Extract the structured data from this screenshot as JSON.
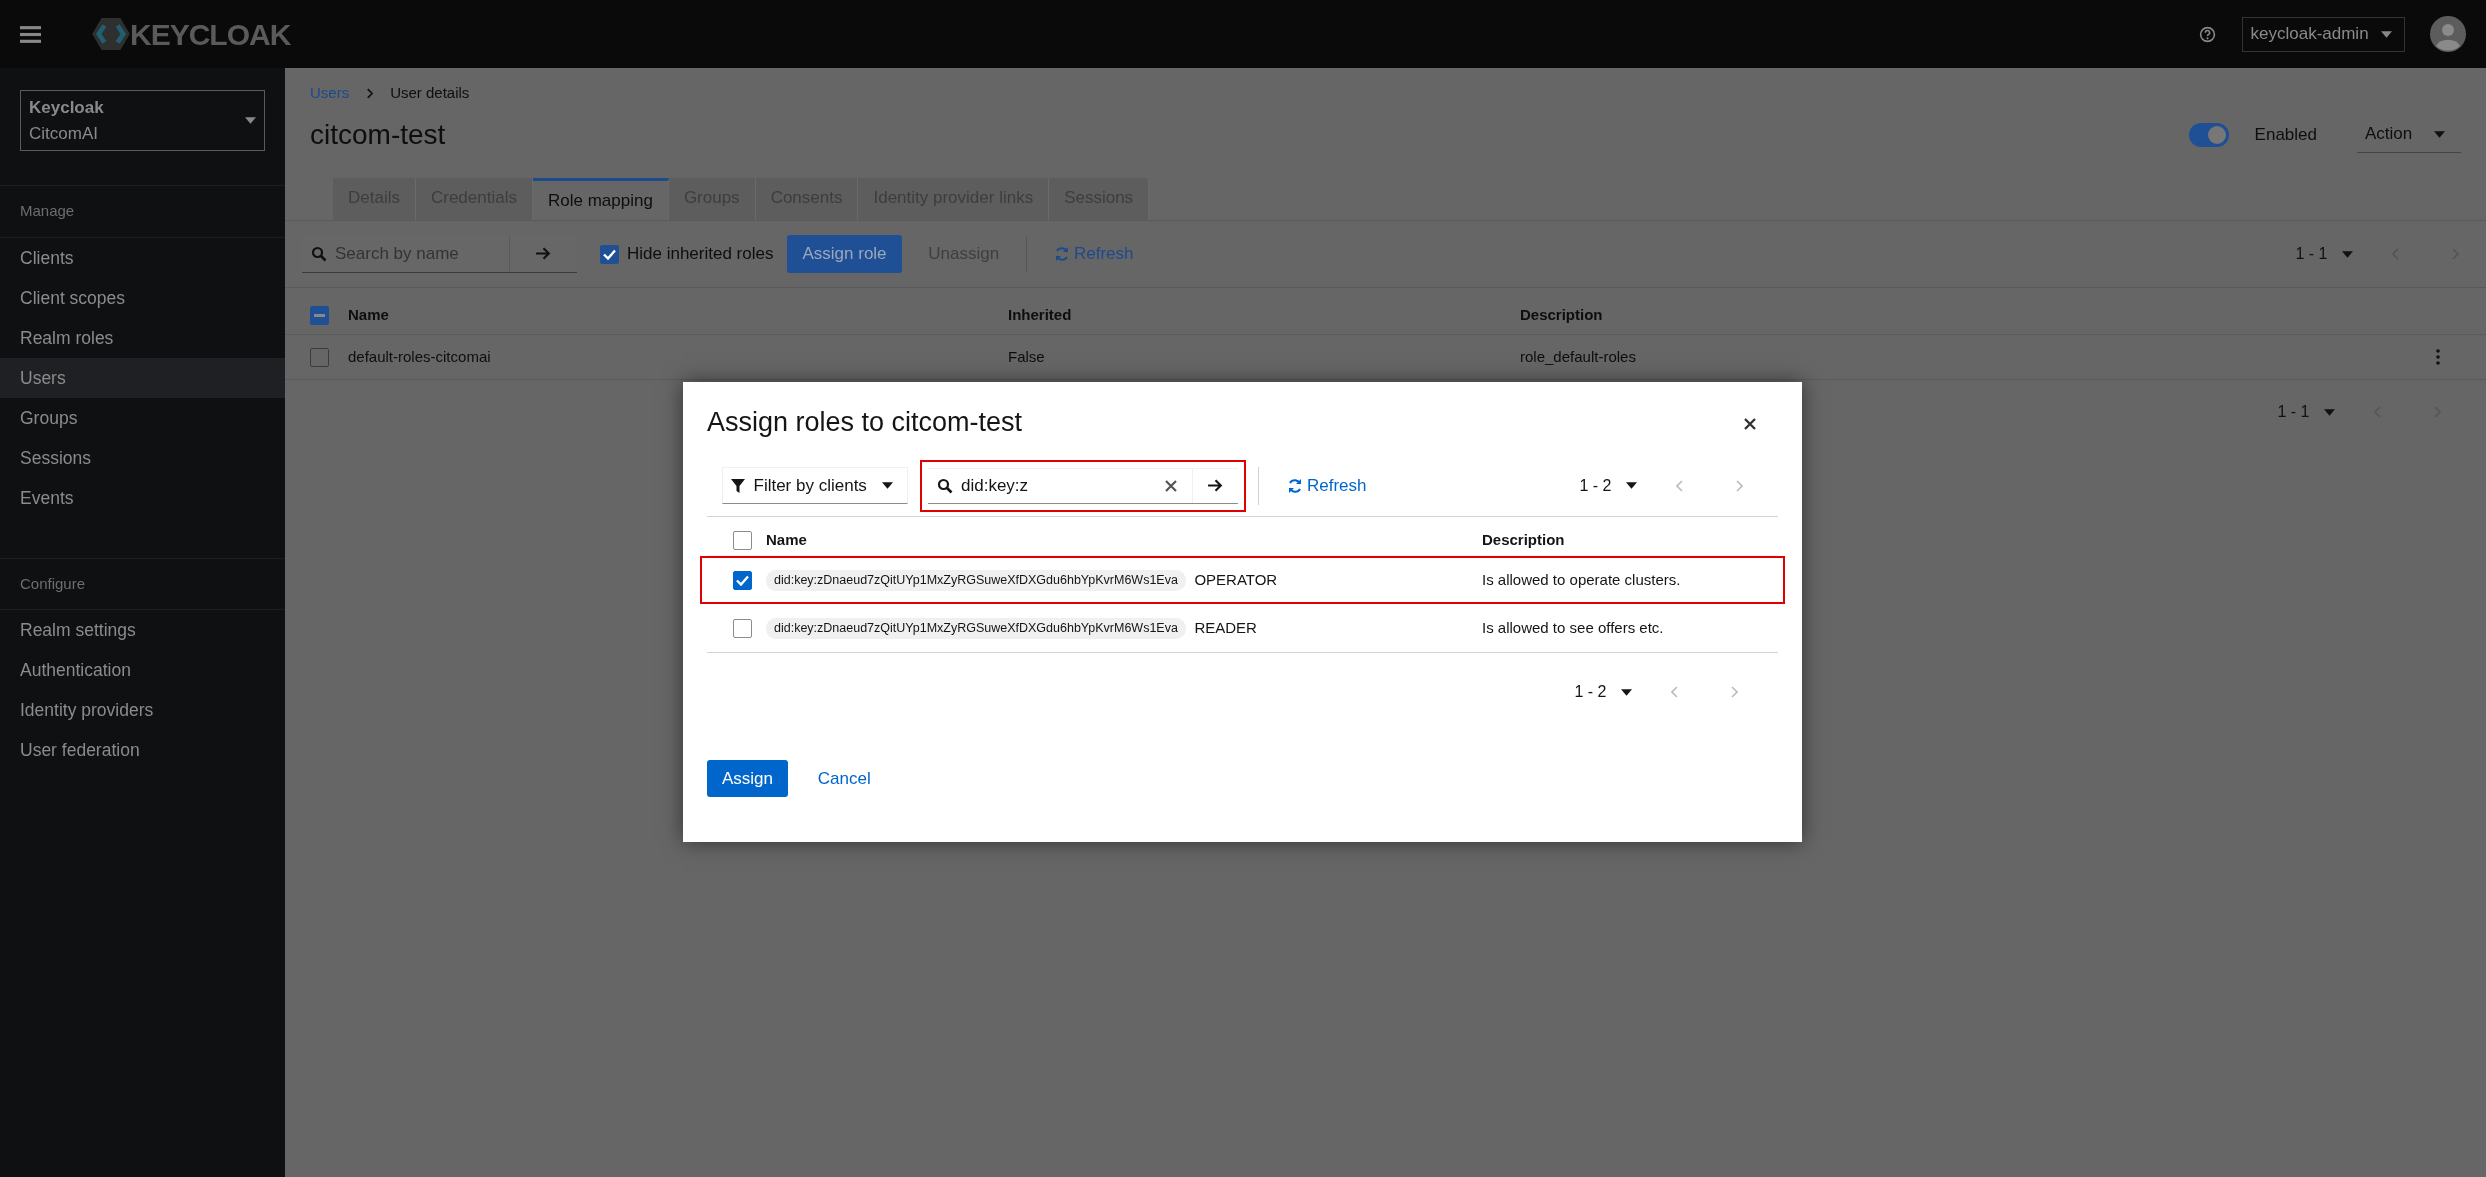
{
  "topbar": {
    "brand": "KEYCLOAK",
    "user": "keycloak-admin"
  },
  "realm_selector": {
    "label": "Keycloak",
    "value": "CitcomAI"
  },
  "sidebar": {
    "sections": [
      {
        "heading": "Manage",
        "items": [
          {
            "label": "Clients",
            "selected": false
          },
          {
            "label": "Client scopes",
            "selected": false
          },
          {
            "label": "Realm roles",
            "selected": false
          },
          {
            "label": "Users",
            "selected": true
          },
          {
            "label": "Groups",
            "selected": false
          },
          {
            "label": "Sessions",
            "selected": false
          },
          {
            "label": "Events",
            "selected": false
          }
        ]
      },
      {
        "heading": "Configure",
        "items": [
          {
            "label": "Realm settings",
            "selected": false
          },
          {
            "label": "Authentication",
            "selected": false
          },
          {
            "label": "Identity providers",
            "selected": false
          },
          {
            "label": "User federation",
            "selected": false
          }
        ]
      }
    ]
  },
  "breadcrumb": [
    "Users",
    "User details"
  ],
  "page": {
    "title": "citcom-test",
    "enabled": {
      "label": "Enabled",
      "on": true
    },
    "action": "Action"
  },
  "tabs": [
    {
      "label": "Details",
      "selected": false
    },
    {
      "label": "Credentials",
      "selected": false
    },
    {
      "label": "Role mapping",
      "selected": true
    },
    {
      "label": "Groups",
      "selected": false
    },
    {
      "label": "Consents",
      "selected": false
    },
    {
      "label": "Identity provider links",
      "selected": false
    },
    {
      "label": "Sessions",
      "selected": false
    }
  ],
  "toolbar": {
    "search_placeholder": "Search by name",
    "hide_inherited": {
      "label": "Hide inherited roles",
      "checked": true
    },
    "assign": "Assign role",
    "unassign": "Unassign",
    "refresh": "Refresh",
    "pagination": "1 - 1"
  },
  "table": {
    "header_checkbox": {
      "indeterminate": true
    },
    "columns": [
      "Name",
      "Inherited",
      "Description"
    ],
    "rows": [
      {
        "name": "default-roles-citcomai",
        "inherited": "False",
        "description": "role_default-roles",
        "checked": false
      }
    ],
    "pagination": "1 - 1"
  },
  "dialog": {
    "title": "Assign roles to citcom-test",
    "filter": "Filter by clients",
    "search": {
      "value": "did:key:z",
      "highlighted": true
    },
    "refresh": "Refresh",
    "pagination": "1 - 2",
    "header_checkbox": {
      "checked": false
    },
    "columns": [
      "Name",
      "Description"
    ],
    "rows": [
      {
        "client": "did:key:zDnaeud7zQitUYp1MxZyRGSuweXfDXGdu6hbYpKvrM6Ws1Eva",
        "name": "OPERATOR",
        "description": "Is allowed to operate clusters.",
        "checked": true,
        "highlighted": true
      },
      {
        "client": "did:key:zDnaeud7zQitUYp1MxZyRGSuweXfDXGdu6hbYpKvrM6Ws1Eva",
        "name": "READER",
        "description": "Is allowed to see offers etc.",
        "checked": false,
        "highlighted": false
      }
    ],
    "bottom_pagination": "1 - 2",
    "buttons": [
      "Assign",
      "Cancel"
    ]
  }
}
